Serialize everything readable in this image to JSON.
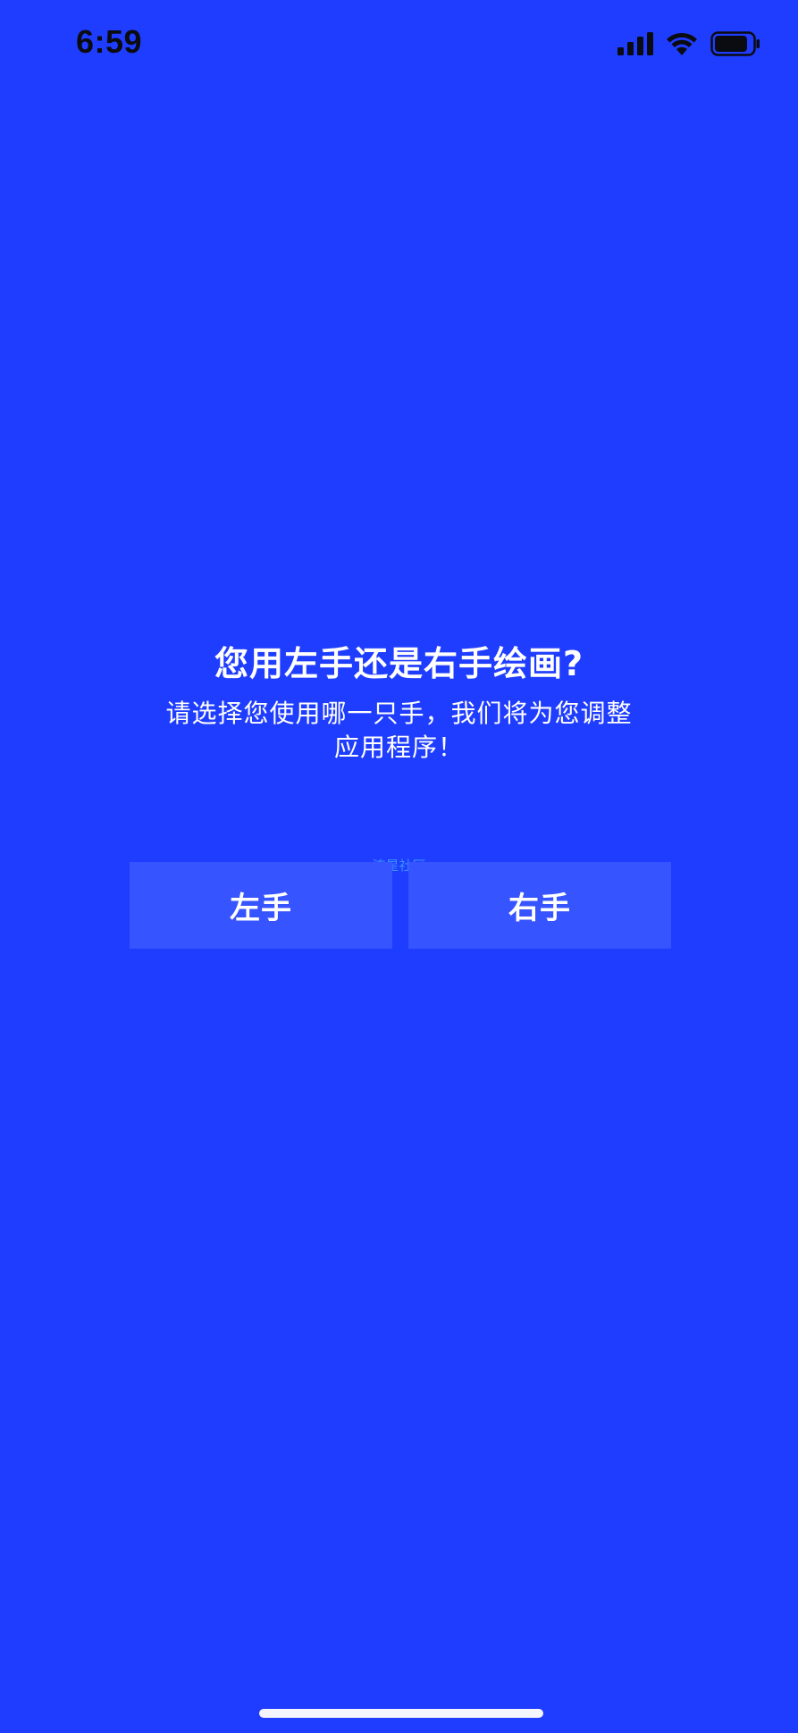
{
  "status_bar": {
    "time": "6:59",
    "icons": [
      "signal-icon",
      "wifi-icon",
      "battery-icon"
    ]
  },
  "prompt": {
    "title": "您用左手还是右手绘画?",
    "subtitle": "请选择您使用哪一只手，我们将为您调整应用程序！"
  },
  "watermark": "流星社区",
  "buttons": {
    "left_hand": "左手",
    "right_hand": "右手"
  },
  "colors": {
    "background": "#1f3dff",
    "button": "#3654ff",
    "text": "#ffffff",
    "status_text": "#0b0b12"
  }
}
